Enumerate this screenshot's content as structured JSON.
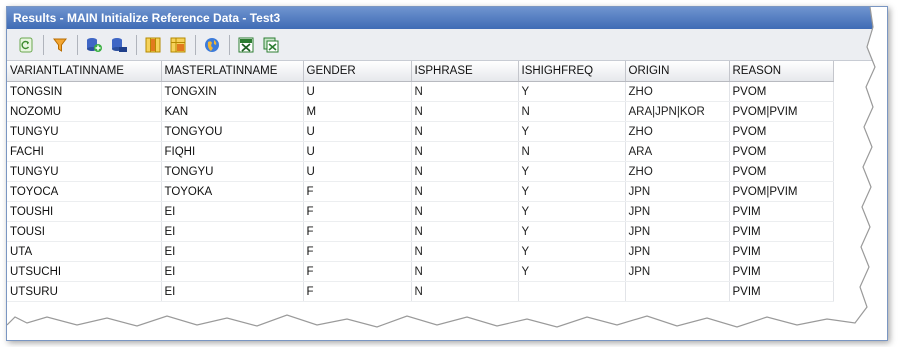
{
  "window": {
    "title": "Results - MAIN Initialize Reference Data - Test3"
  },
  "toolbar": {
    "buttons": [
      {
        "name": "refresh-icon"
      },
      {
        "name": "filter-icon"
      },
      {
        "name": "add-database-icon"
      },
      {
        "name": "export-database-icon"
      },
      {
        "name": "grid-columns-icon"
      },
      {
        "name": "grid-layout-icon"
      },
      {
        "name": "globe-icon"
      },
      {
        "name": "excel-icon"
      },
      {
        "name": "excel-export-icon"
      }
    ]
  },
  "grid": {
    "columns": [
      "VARIANTLATINNAME",
      "MASTERLATINNAME",
      "GENDER",
      "ISPHRASE",
      "ISHIGHFREQ",
      "ORIGIN",
      "REASON"
    ],
    "rows": [
      [
        "TONGSIN",
        "TONGXIN",
        "U",
        "N",
        "Y",
        "ZHO",
        "PVOM"
      ],
      [
        "NOZOMU",
        "KAN",
        "M",
        "N",
        "N",
        "ARA|JPN|KOR",
        "PVOM|PVIM"
      ],
      [
        "TUNGYU",
        "TONGYOU",
        "U",
        "N",
        "Y",
        "ZHO",
        "PVOM"
      ],
      [
        "FACHI",
        "FIQHI",
        "U",
        "N",
        "N",
        "ARA",
        "PVOM"
      ],
      [
        "TUNGYU",
        "TONGYU",
        "U",
        "N",
        "Y",
        "ZHO",
        "PVOM"
      ],
      [
        "TOYOCA",
        "TOYOKA",
        "F",
        "N",
        "Y",
        "JPN",
        "PVOM|PVIM"
      ],
      [
        "TOUSHI",
        "EI",
        "F",
        "N",
        "Y",
        "JPN",
        "PVIM"
      ],
      [
        "TOUSI",
        "EI",
        "F",
        "N",
        "Y",
        "JPN",
        "PVIM"
      ],
      [
        "UTA",
        "EI",
        "F",
        "N",
        "Y",
        "JPN",
        "PVIM"
      ],
      [
        "UTSUCHI",
        "EI",
        "F",
        "N",
        "Y",
        "JPN",
        "PVIM"
      ],
      [
        "UTSURU",
        "EI",
        "F",
        "N",
        "",
        "",
        "PVIM"
      ]
    ]
  }
}
